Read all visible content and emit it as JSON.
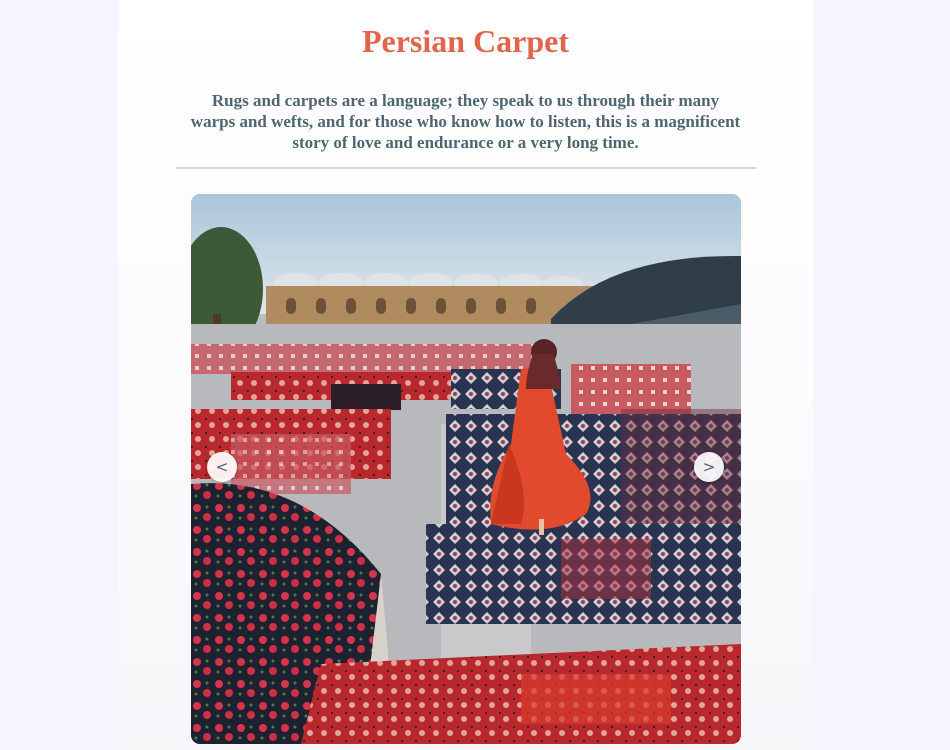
{
  "page": {
    "title": "Persian Carpet",
    "intro": "Rugs and carpets are a language; they speak to us through their many warps and wefts, and for those who know how to listen, this is a magnificent story of love and endurance or a very long time."
  },
  "carousel": {
    "prev_label": "<",
    "next_label": ">",
    "image_subject": "woman in red dress walking across rooftop covered with Persian carpets"
  },
  "colors": {
    "title": "#e0654d",
    "intro_text": "#4d6670",
    "background": "#f7f4fd",
    "carpet_red": "#c0282a",
    "carpet_navy": "#1f2a44"
  }
}
